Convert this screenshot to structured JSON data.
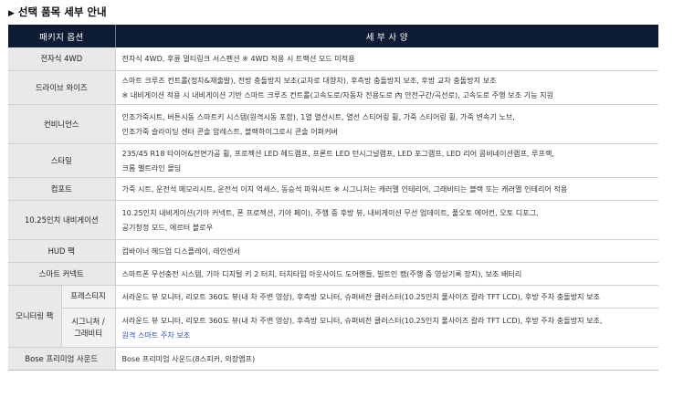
{
  "page": {
    "title": "선택 품목 세부 안내"
  },
  "table": {
    "headers": {
      "package": "패키지 옵션",
      "details": "세 부 사 양"
    },
    "rows": [
      {
        "option": "전자식 4WD",
        "lines": [
          "전자식 4WD, 후륜 멀티링크 서스펜션  ※ 4WD 적용 시 트랙션 모드 미적용"
        ]
      },
      {
        "option": "드라이브 와이즈",
        "lines": [
          "스마트 크루즈 컨트롤(정차&재출발), 전방 충돌방지 보조(교차로 대향차), 후측방 충돌방지 보조, 후방 교차 충돌방지 보조",
          "※ 내비게이션 적용 시 내비게이션 기반 스마트 크루즈 컨트롤(고속도로/자동차 전용도로 內 안전구간/곡선로), 고속도로 주행 보조 기능 지원"
        ]
      },
      {
        "option": "컨비니언스",
        "lines": [
          "인조가죽시트, 버튼시동 스마트키 시스템(원격시동 포함), 1열 열선시트, 열선 스티어링 휠, 가죽 스티어링 휠, 가죽 변속기 노브,",
          "인조가죽 슬라이딩 센터 콘솔 암레스트, 블랙하이그로시 콘솔 어퍼커버"
        ]
      },
      {
        "option": "스타일",
        "lines": [
          "235/45 R18 타이어&전면가공 휠, 프로젝션 LED 헤드램프, 프론트 LED 턴시그널램프, LED 포그램프, LED 리어 콤비네이션램프, 루프랙,",
          "크롬 벨트라인 몰딩"
        ]
      },
      {
        "option": "컴포트",
        "lines": [
          "가죽 시트, 운전석 메모리시트, 운전석 이지 억세스, 동승석 파워시트  ※ 시그니처는 캐러멜 인테리어, 그래비티는 블랙 또는 캐러멜 인테리어 적용"
        ]
      },
      {
        "option": "10.25인치 내비게이션",
        "lines": [
          "10.25인치 내비게이션(기아 커넥트, 폰 프로젝션, 기아 페이), 주행 중 후방 뷰, 내비게이션 무선 업데이트, 풀오토 에어컨, 오토 디포그,",
          "공기청정 모드, 에르터 블로우"
        ]
      },
      {
        "option": "HUD 팩",
        "lines": [
          "컴바이너 헤드업 디스플레이, 레인센서"
        ]
      },
      {
        "option": "스마트 커넥트",
        "lines": [
          "스마트폰 무선충전 시스템, 기아 디지털 키 2 터치, 터치타입 아웃사이드 도어핸들, 빌트인 캠(주행 중 영상기록 장치), 보조 배터리"
        ]
      }
    ],
    "monitoring": {
      "option": "모니터링 팩",
      "sub_rows": [
        {
          "trim": "프레스티지",
          "lines": [
            "서라운드 뷰 모니터, 리모트 360도 뷰(내 차 주변 영상), 후측방 모니터, 슈퍼비전 클러스터(10.25인치 풀사이즈 칼라 TFT LCD), 후방 주차 충돌방지 보조"
          ]
        },
        {
          "trim": "시그니처 / 그래비티",
          "lines": [
            "서라운드 뷰 모니터, 리모트 360도 뷰(내 차 주변 영상), 후측방 모니터, 슈퍼비전 클러스터(10.25인치 풀사이즈 칼라 TFT LCD), 후방 주차 충돌방지 보조,"
          ],
          "link": "원격 스마트 주차 보조"
        }
      ]
    },
    "bose": {
      "option": "Bose 프리미엄 사운드",
      "lines": [
        "Bose 프리미엄 사운드(8스피커, 외장앰프)"
      ]
    }
  }
}
